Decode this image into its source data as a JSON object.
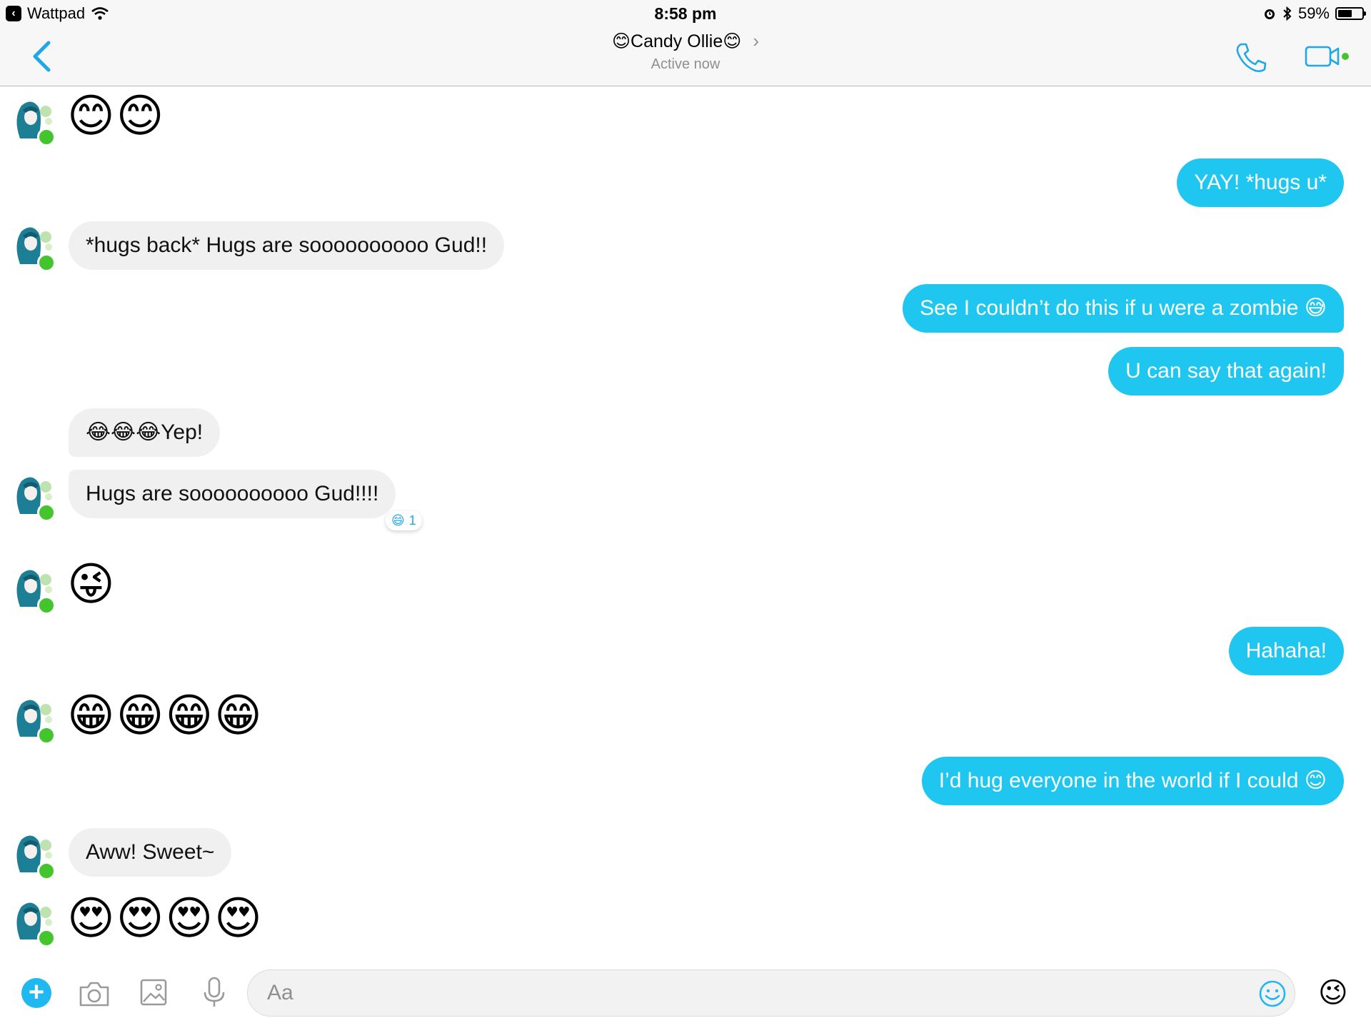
{
  "status_bar": {
    "back_app": "Wattpad",
    "time": "8:58 pm",
    "battery": "59%",
    "battery_level": 0.59
  },
  "header": {
    "title": "😊Candy Ollie😊",
    "subtitle": "Active now",
    "chevron": "›",
    "icons": [
      "back-chevron-icon",
      "phone-icon",
      "video-camera-icon"
    ]
  },
  "messages": [
    {
      "from": "them",
      "text": "😊😊"
    },
    {
      "from": "me",
      "text": "YAY! *hugs u*"
    },
    {
      "from": "them",
      "text": "*hugs back* Hugs are soooooooooo Gud!!"
    },
    {
      "from": "me",
      "text": "See I couldn’t do this if u were a zombie 😅"
    },
    {
      "from": "me",
      "text": "U can say that again!"
    },
    {
      "from": "them",
      "text": "😂😂😂Yep!"
    },
    {
      "from": "them",
      "text": "Hugs are soooooooooo Gud!!!!",
      "reaction": {
        "emoji": "😄",
        "count": "1"
      }
    },
    {
      "from": "them",
      "text": "😜"
    },
    {
      "from": "me",
      "text": "Hahaha!"
    },
    {
      "from": "them",
      "text": "😁😁😁😁"
    },
    {
      "from": "me",
      "text": "I’d hug everyone in the world if I could 😊"
    },
    {
      "from": "them",
      "text": "Aww! Sweet~"
    },
    {
      "from": "them",
      "text": "😍😍😍😍"
    }
  ],
  "composer": {
    "plus": "+",
    "placeholder": "Aa",
    "emoji_button": "😉",
    "icons": [
      "plus-icon",
      "camera-icon",
      "image-icon",
      "microphone-icon",
      "smiley-icon"
    ]
  }
}
